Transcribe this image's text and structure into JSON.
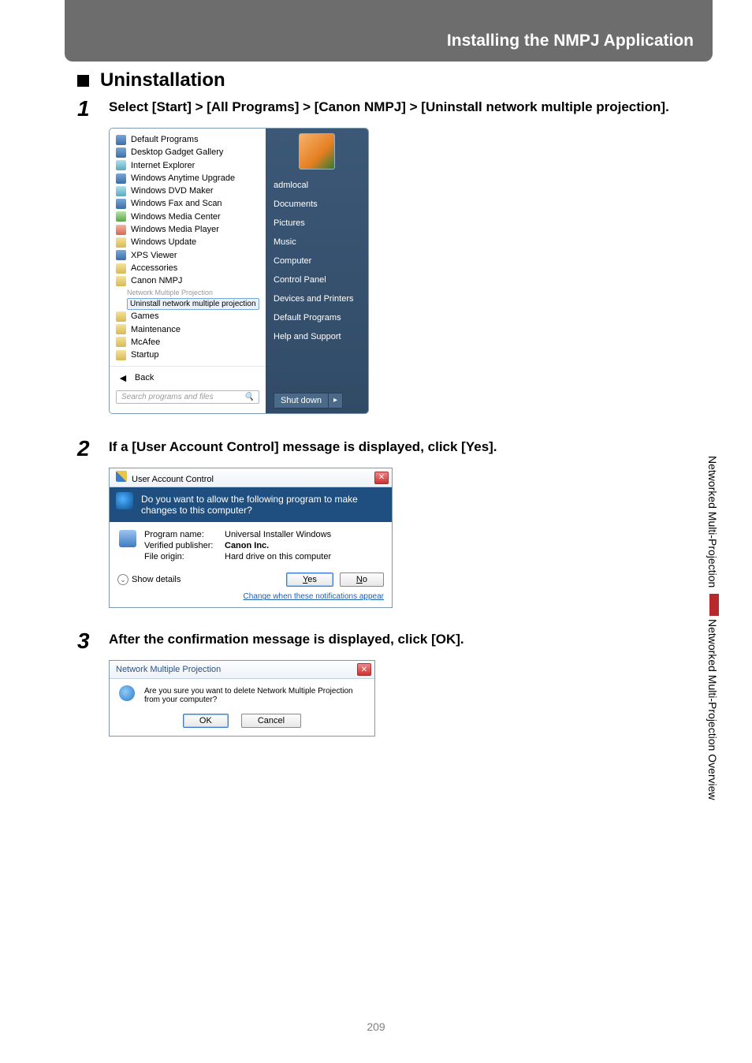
{
  "header": {
    "title": "Installing the NMPJ Application"
  },
  "section_heading": "Uninstallation",
  "steps": {
    "s1": {
      "num": "1",
      "text": "Select [Start] > [All Programs] > [Canon NMPJ] > [Uninstall network multiple projection]."
    },
    "s2": {
      "num": "2",
      "text": "If a [User Account Control] message is displayed, click [Yes]."
    },
    "s3": {
      "num": "3",
      "text": "After the confirmation message is displayed, click [OK]."
    }
  },
  "start_menu": {
    "left_items": [
      "Default Programs",
      "Desktop Gadget Gallery",
      "Internet Explorer",
      "Windows Anytime Upgrade",
      "Windows DVD Maker",
      "Windows Fax and Scan",
      "Windows Media Center",
      "Windows Media Player",
      "Windows Update",
      "XPS Viewer",
      "Accessories",
      "Canon NMPJ"
    ],
    "sub_item_faded": "Network Multiple Projection",
    "highlight": "Uninstall network multiple projection",
    "left_items_after": [
      "Games",
      "Maintenance",
      "McAfee",
      "Startup"
    ],
    "back": "Back",
    "search_placeholder": "Search programs and files",
    "user": "admlocal",
    "right_items": [
      "Documents",
      "Pictures",
      "Music",
      "Computer",
      "Control Panel",
      "Devices and Printers",
      "Default Programs",
      "Help and Support"
    ],
    "shutdown": "Shut down"
  },
  "uac": {
    "title": "User Account Control",
    "question": "Do you want to allow the following program to make changes to this computer?",
    "rows": {
      "program_name_lbl": "Program name:",
      "program_name_val": "Universal Installer Windows",
      "publisher_lbl": "Verified publisher:",
      "publisher_val": "Canon Inc.",
      "origin_lbl": "File origin:",
      "origin_val": "Hard drive on this computer"
    },
    "show_details": "Show details",
    "yes": "Yes",
    "no": "No",
    "link": "Change when these notifications appear"
  },
  "confirm": {
    "title": "Network Multiple Projection",
    "message": "Are you sure you want to delete Network Multiple Projection from your computer?",
    "ok": "OK",
    "cancel": "Cancel"
  },
  "side": {
    "label1": "Networked Multi-Projection",
    "label2": "Networked Multi-Projection Overview"
  },
  "page_number": "209"
}
